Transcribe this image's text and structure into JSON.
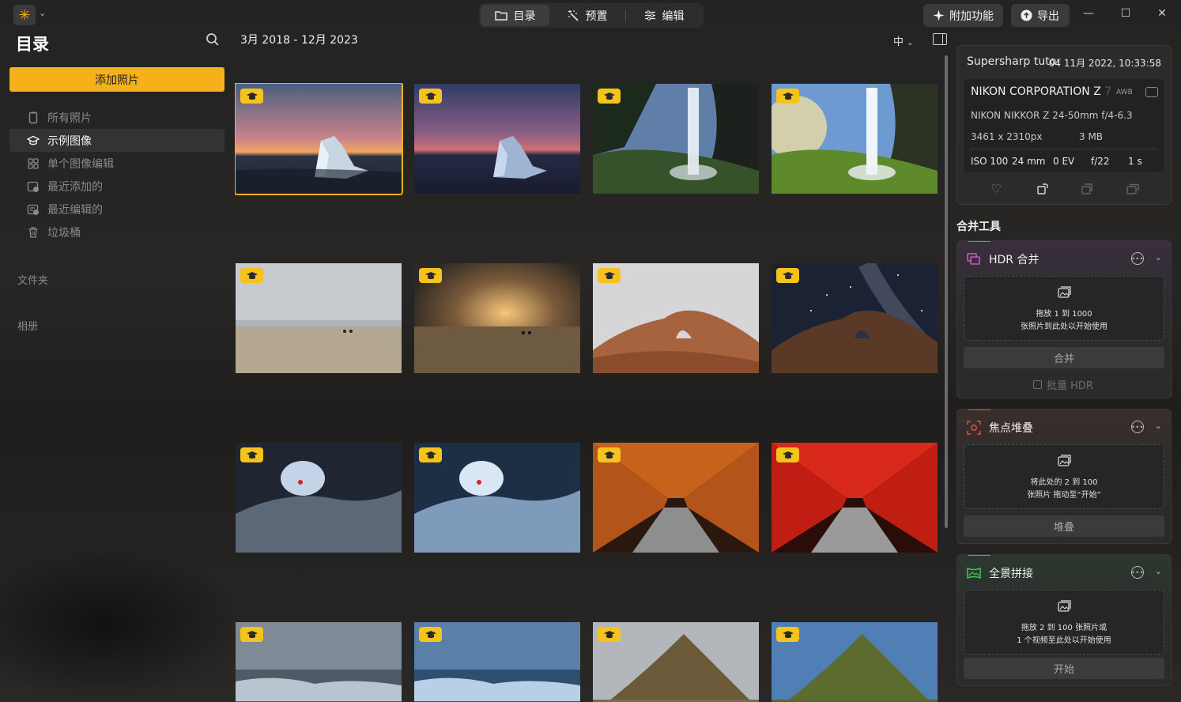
{
  "app": {
    "logo_glyph": "✳",
    "accent": "#f6b01c"
  },
  "top_tabs": [
    {
      "label": "目录",
      "active": true,
      "icon": "folder-icon"
    },
    {
      "label": "预置",
      "active": false,
      "icon": "magic-wand-icon"
    },
    {
      "label": "编辑",
      "active": false,
      "icon": "sliders-icon"
    }
  ],
  "top_actions": {
    "extras": "附加功能",
    "export": "导出"
  },
  "sidebar": {
    "title": "目录",
    "add_photos": "添加照片",
    "items": [
      {
        "label": "所有照片",
        "icon": "phone-icon",
        "active": false
      },
      {
        "label": "示例图像",
        "icon": "graduation-cap-icon",
        "active": true
      },
      {
        "label": "单个图像编辑",
        "icon": "grid-icon",
        "active": false
      },
      {
        "label": "最近添加的",
        "icon": "recent-added-icon",
        "active": false
      },
      {
        "label": "最近编辑的",
        "icon": "recent-edited-icon",
        "active": false
      },
      {
        "label": "垃圾桶",
        "icon": "trash-icon",
        "active": false
      }
    ],
    "folders_label": "文件夹",
    "albums_label": "相册"
  },
  "main": {
    "date_range": "3月 2018 - 12月 2023",
    "thumb_size": "中"
  },
  "info": {
    "title": "Supersharp tuto",
    "title_fade": "r",
    "date": "04 11月 2022, 10:33:58",
    "camera": "NIKON CORPORATION Z",
    "camera_fade": " 7",
    "awb": "AWB",
    "lens": "NIKON NIKKOR Z 24-50mm f/4-6.3",
    "dimensions": "3461 x 2310px",
    "filesize": "3 MB",
    "iso": "ISO 100",
    "focal": "24 mm",
    "ev": "0 EV",
    "aperture": "f/22",
    "shutter": "1 s"
  },
  "merge": {
    "title": "合并工具",
    "hdr": {
      "title": "HDR 合并",
      "accent": "#c05cc8",
      "drop_l1": "拖放 1 到 1000",
      "drop_l2": "张照片到此处以开始使用",
      "button": "合并",
      "batch": "批量 HDR"
    },
    "focus": {
      "title": "焦点堆叠",
      "accent": "#e0523a",
      "drop_l1": "将此处的 2 到 100",
      "drop_l2": "张照片 拖动至“开始”",
      "button": "堆叠"
    },
    "pano": {
      "title": "全景拼接",
      "accent": "#3cc455",
      "drop_l1": "拖放 2 到 100 张照片或",
      "drop_l2": "1 个视频至此处以开始使用",
      "button": "开始"
    }
  }
}
